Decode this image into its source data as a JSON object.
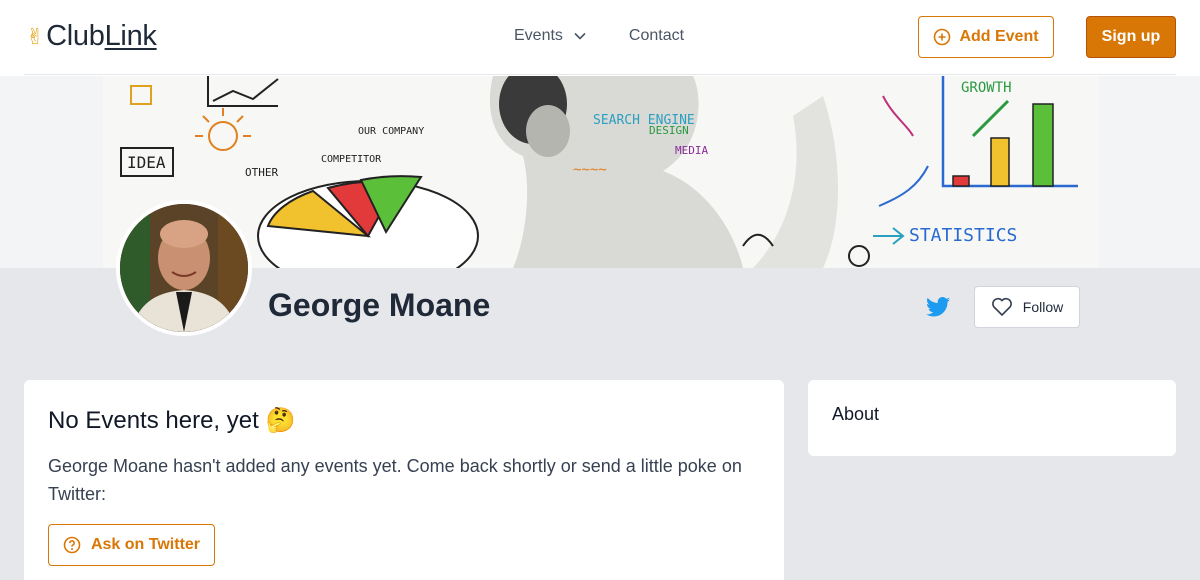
{
  "header": {
    "logo_text": "ClubLink",
    "logo_prefix": "Club",
    "logo_suffix": "Link",
    "nav": {
      "events_label": "Events",
      "contact_label": "Contact"
    },
    "add_event_label": "Add Event",
    "signup_label": "Sign up"
  },
  "banner": {
    "words": [
      "IDEA",
      "OTHER",
      "OUR COMPANY",
      "COMPETITOR",
      "SEARCH ENGINE",
      "DESIGN",
      "MEDIA",
      "GROWTH",
      "STATISTICS"
    ]
  },
  "profile": {
    "name": "George Moane",
    "follow_label": "Follow"
  },
  "events_card": {
    "title": "No Events here, yet 🤔",
    "message": "George Moane hasn't added any events yet. Come back shortly or send a little poke on Twitter:",
    "ask_label": "Ask on Twitter"
  },
  "about_card": {
    "title": "About"
  },
  "colors": {
    "accent": "#d97706",
    "twitter": "#1d9bf0",
    "page_bg": "#e5e7eb"
  }
}
